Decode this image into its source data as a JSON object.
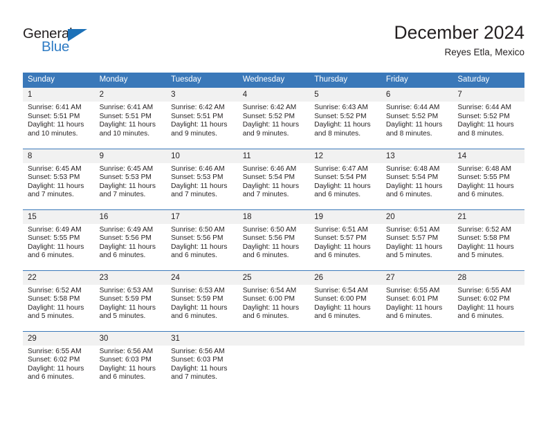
{
  "brand": {
    "name_top": "General",
    "name_bottom": "Blue",
    "triangle_color": "#1d71b8",
    "text_color": "#231f20",
    "blue_color": "#2e7bc4"
  },
  "header": {
    "title": "December 2024",
    "subtitle": "Reyes Etla, Mexico"
  },
  "colors": {
    "header_blue": "#3a78b9",
    "daynum_gray": "#f1f1f1",
    "text": "#231f20"
  },
  "calendar": {
    "weekday_headers": [
      "Sunday",
      "Monday",
      "Tuesday",
      "Wednesday",
      "Thursday",
      "Friday",
      "Saturday"
    ],
    "weeks": [
      [
        {
          "day": "1",
          "sunrise": "Sunrise: 6:41 AM",
          "sunset": "Sunset: 5:51 PM",
          "daylight_1": "Daylight: 11 hours",
          "daylight_2": "and 10 minutes."
        },
        {
          "day": "2",
          "sunrise": "Sunrise: 6:41 AM",
          "sunset": "Sunset: 5:51 PM",
          "daylight_1": "Daylight: 11 hours",
          "daylight_2": "and 10 minutes."
        },
        {
          "day": "3",
          "sunrise": "Sunrise: 6:42 AM",
          "sunset": "Sunset: 5:51 PM",
          "daylight_1": "Daylight: 11 hours",
          "daylight_2": "and 9 minutes."
        },
        {
          "day": "4",
          "sunrise": "Sunrise: 6:42 AM",
          "sunset": "Sunset: 5:52 PM",
          "daylight_1": "Daylight: 11 hours",
          "daylight_2": "and 9 minutes."
        },
        {
          "day": "5",
          "sunrise": "Sunrise: 6:43 AM",
          "sunset": "Sunset: 5:52 PM",
          "daylight_1": "Daylight: 11 hours",
          "daylight_2": "and 8 minutes."
        },
        {
          "day": "6",
          "sunrise": "Sunrise: 6:44 AM",
          "sunset": "Sunset: 5:52 PM",
          "daylight_1": "Daylight: 11 hours",
          "daylight_2": "and 8 minutes."
        },
        {
          "day": "7",
          "sunrise": "Sunrise: 6:44 AM",
          "sunset": "Sunset: 5:52 PM",
          "daylight_1": "Daylight: 11 hours",
          "daylight_2": "and 8 minutes."
        }
      ],
      [
        {
          "day": "8",
          "sunrise": "Sunrise: 6:45 AM",
          "sunset": "Sunset: 5:53 PM",
          "daylight_1": "Daylight: 11 hours",
          "daylight_2": "and 7 minutes."
        },
        {
          "day": "9",
          "sunrise": "Sunrise: 6:45 AM",
          "sunset": "Sunset: 5:53 PM",
          "daylight_1": "Daylight: 11 hours",
          "daylight_2": "and 7 minutes."
        },
        {
          "day": "10",
          "sunrise": "Sunrise: 6:46 AM",
          "sunset": "Sunset: 5:53 PM",
          "daylight_1": "Daylight: 11 hours",
          "daylight_2": "and 7 minutes."
        },
        {
          "day": "11",
          "sunrise": "Sunrise: 6:46 AM",
          "sunset": "Sunset: 5:54 PM",
          "daylight_1": "Daylight: 11 hours",
          "daylight_2": "and 7 minutes."
        },
        {
          "day": "12",
          "sunrise": "Sunrise: 6:47 AM",
          "sunset": "Sunset: 5:54 PM",
          "daylight_1": "Daylight: 11 hours",
          "daylight_2": "and 6 minutes."
        },
        {
          "day": "13",
          "sunrise": "Sunrise: 6:48 AM",
          "sunset": "Sunset: 5:54 PM",
          "daylight_1": "Daylight: 11 hours",
          "daylight_2": "and 6 minutes."
        },
        {
          "day": "14",
          "sunrise": "Sunrise: 6:48 AM",
          "sunset": "Sunset: 5:55 PM",
          "daylight_1": "Daylight: 11 hours",
          "daylight_2": "and 6 minutes."
        }
      ],
      [
        {
          "day": "15",
          "sunrise": "Sunrise: 6:49 AM",
          "sunset": "Sunset: 5:55 PM",
          "daylight_1": "Daylight: 11 hours",
          "daylight_2": "and 6 minutes."
        },
        {
          "day": "16",
          "sunrise": "Sunrise: 6:49 AM",
          "sunset": "Sunset: 5:56 PM",
          "daylight_1": "Daylight: 11 hours",
          "daylight_2": "and 6 minutes."
        },
        {
          "day": "17",
          "sunrise": "Sunrise: 6:50 AM",
          "sunset": "Sunset: 5:56 PM",
          "daylight_1": "Daylight: 11 hours",
          "daylight_2": "and 6 minutes."
        },
        {
          "day": "18",
          "sunrise": "Sunrise: 6:50 AM",
          "sunset": "Sunset: 5:56 PM",
          "daylight_1": "Daylight: 11 hours",
          "daylight_2": "and 6 minutes."
        },
        {
          "day": "19",
          "sunrise": "Sunrise: 6:51 AM",
          "sunset": "Sunset: 5:57 PM",
          "daylight_1": "Daylight: 11 hours",
          "daylight_2": "and 6 minutes."
        },
        {
          "day": "20",
          "sunrise": "Sunrise: 6:51 AM",
          "sunset": "Sunset: 5:57 PM",
          "daylight_1": "Daylight: 11 hours",
          "daylight_2": "and 5 minutes."
        },
        {
          "day": "21",
          "sunrise": "Sunrise: 6:52 AM",
          "sunset": "Sunset: 5:58 PM",
          "daylight_1": "Daylight: 11 hours",
          "daylight_2": "and 5 minutes."
        }
      ],
      [
        {
          "day": "22",
          "sunrise": "Sunrise: 6:52 AM",
          "sunset": "Sunset: 5:58 PM",
          "daylight_1": "Daylight: 11 hours",
          "daylight_2": "and 5 minutes."
        },
        {
          "day": "23",
          "sunrise": "Sunrise: 6:53 AM",
          "sunset": "Sunset: 5:59 PM",
          "daylight_1": "Daylight: 11 hours",
          "daylight_2": "and 5 minutes."
        },
        {
          "day": "24",
          "sunrise": "Sunrise: 6:53 AM",
          "sunset": "Sunset: 5:59 PM",
          "daylight_1": "Daylight: 11 hours",
          "daylight_2": "and 6 minutes."
        },
        {
          "day": "25",
          "sunrise": "Sunrise: 6:54 AM",
          "sunset": "Sunset: 6:00 PM",
          "daylight_1": "Daylight: 11 hours",
          "daylight_2": "and 6 minutes."
        },
        {
          "day": "26",
          "sunrise": "Sunrise: 6:54 AM",
          "sunset": "Sunset: 6:00 PM",
          "daylight_1": "Daylight: 11 hours",
          "daylight_2": "and 6 minutes."
        },
        {
          "day": "27",
          "sunrise": "Sunrise: 6:55 AM",
          "sunset": "Sunset: 6:01 PM",
          "daylight_1": "Daylight: 11 hours",
          "daylight_2": "and 6 minutes."
        },
        {
          "day": "28",
          "sunrise": "Sunrise: 6:55 AM",
          "sunset": "Sunset: 6:02 PM",
          "daylight_1": "Daylight: 11 hours",
          "daylight_2": "and 6 minutes."
        }
      ],
      [
        {
          "day": "29",
          "sunrise": "Sunrise: 6:55 AM",
          "sunset": "Sunset: 6:02 PM",
          "daylight_1": "Daylight: 11 hours",
          "daylight_2": "and 6 minutes."
        },
        {
          "day": "30",
          "sunrise": "Sunrise: 6:56 AM",
          "sunset": "Sunset: 6:03 PM",
          "daylight_1": "Daylight: 11 hours",
          "daylight_2": "and 6 minutes."
        },
        {
          "day": "31",
          "sunrise": "Sunrise: 6:56 AM",
          "sunset": "Sunset: 6:03 PM",
          "daylight_1": "Daylight: 11 hours",
          "daylight_2": "and 7 minutes."
        },
        {
          "day": "",
          "sunrise": "",
          "sunset": "",
          "daylight_1": "",
          "daylight_2": ""
        },
        {
          "day": "",
          "sunrise": "",
          "sunset": "",
          "daylight_1": "",
          "daylight_2": ""
        },
        {
          "day": "",
          "sunrise": "",
          "sunset": "",
          "daylight_1": "",
          "daylight_2": ""
        },
        {
          "day": "",
          "sunrise": "",
          "sunset": "",
          "daylight_1": "",
          "daylight_2": ""
        }
      ]
    ]
  }
}
